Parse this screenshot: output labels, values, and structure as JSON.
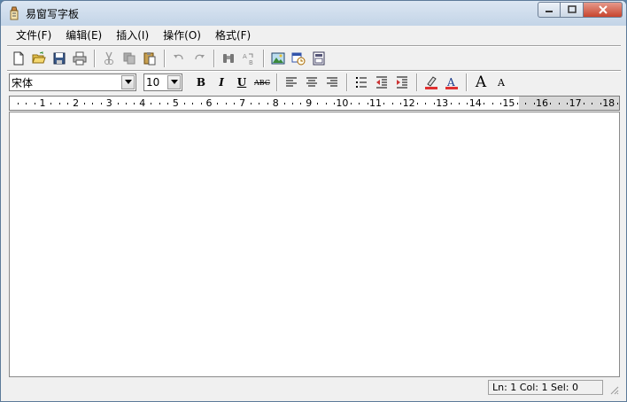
{
  "window": {
    "title": "易窗写字板"
  },
  "menu": [
    {
      "key": "file",
      "label": "文件(F)"
    },
    {
      "key": "edit",
      "label": "编辑(E)"
    },
    {
      "key": "insert",
      "label": "插入(I)"
    },
    {
      "key": "operate",
      "label": "操作(O)"
    },
    {
      "key": "format",
      "label": "格式(F)"
    }
  ],
  "format_bar": {
    "font_name": "宋体",
    "font_size": "10",
    "bold_label": "B",
    "italic_label": "I",
    "underline_label": "U",
    "strike_label": "ABC",
    "grow_label": "A",
    "shrink_label": "A"
  },
  "ruler": {
    "numbers": [
      "1",
      "2",
      "3",
      "4",
      "5",
      "6",
      "7",
      "8",
      "9",
      "10",
      "11",
      "12",
      "13",
      "14",
      "15",
      "16",
      "17",
      "18"
    ]
  },
  "status": {
    "position": "Ln: 1 Col: 1 Sel: 0"
  },
  "colors": {
    "highlight": "#e03030",
    "font_color": "#e03030",
    "accent": "#3a6ea5"
  }
}
